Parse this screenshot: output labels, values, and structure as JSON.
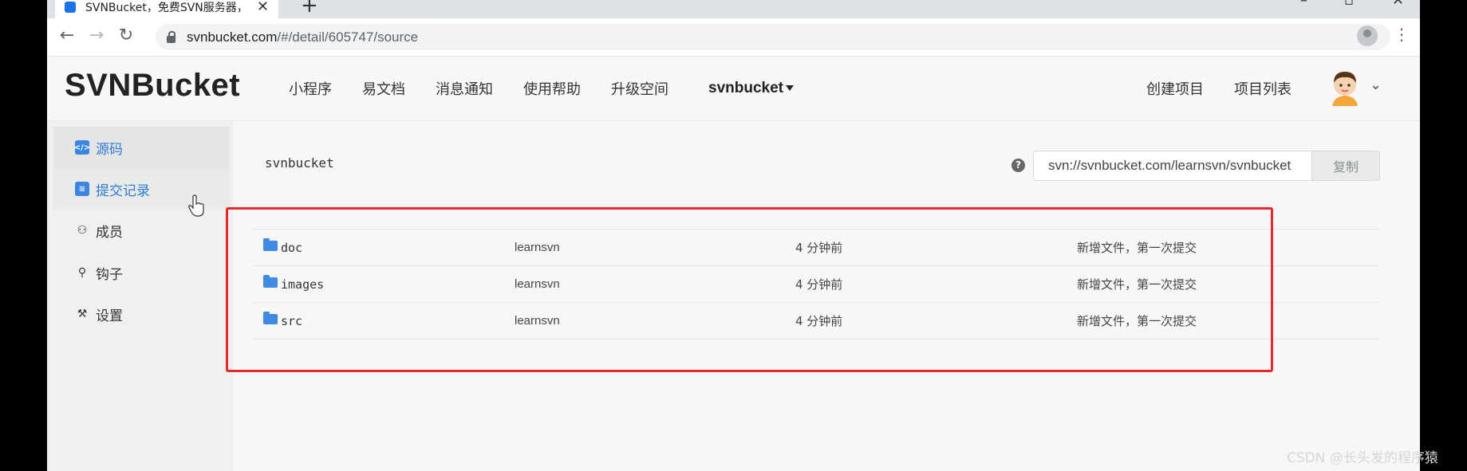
{
  "browser": {
    "tab_title": "SVNBucket，免费SVN服务器，",
    "tab_close": "✕",
    "new_tab": "+",
    "url_host": "svnbucket.com",
    "url_path": "/#/detail/605747/source"
  },
  "app": {
    "logo": "SVNBucket",
    "nav": [
      "小程序",
      "易文档",
      "消息通知",
      "使用帮助",
      "升级空间"
    ],
    "project_dropdown": "svnbucket",
    "right_nav": [
      "创建项目",
      "项目列表"
    ]
  },
  "sidebar": {
    "items": [
      {
        "label": "源码",
        "icon": "code-icon"
      },
      {
        "label": "提交记录",
        "icon": "commit-log-icon"
      },
      {
        "label": "成员",
        "icon": "members-icon"
      },
      {
        "label": "钩子",
        "icon": "hook-icon"
      },
      {
        "label": "设置",
        "icon": "wrench-icon"
      }
    ]
  },
  "main": {
    "repo_name": "svnbucket",
    "help": "?",
    "checkout_url": "svn://svnbucket.com/learnsvn/svnbucket",
    "copy_label": "复制",
    "files": [
      {
        "name": "doc",
        "author": "learnsvn",
        "time": "4 分钟前",
        "message": "新增文件，第一次提交"
      },
      {
        "name": "images",
        "author": "learnsvn",
        "time": "4 分钟前",
        "message": "新增文件，第一次提交"
      },
      {
        "name": "src",
        "author": "learnsvn",
        "time": "4 分钟前",
        "message": "新增文件，第一次提交"
      }
    ]
  },
  "watermark": "CSDN @长头发的程序猿",
  "colors": {
    "accent": "#2f7ad8",
    "highlight_border": "#e62a2a",
    "folder": "#3f8be3"
  }
}
